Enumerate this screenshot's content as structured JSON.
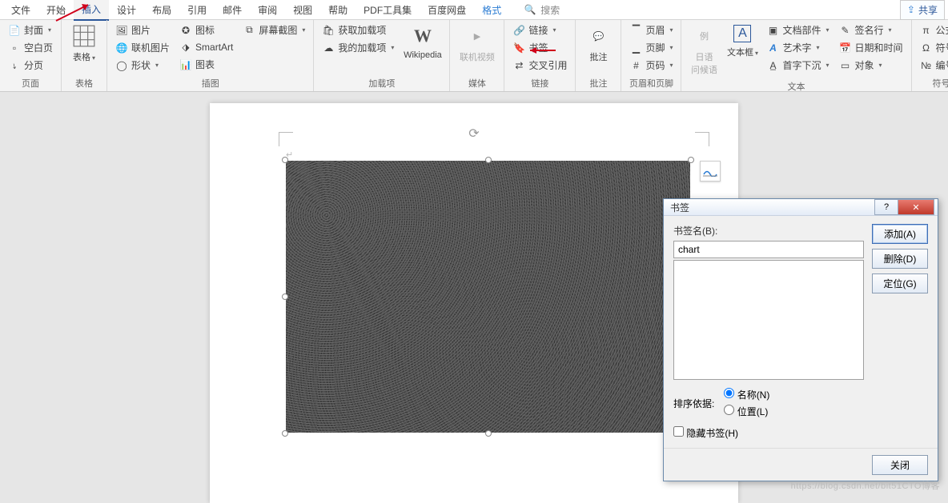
{
  "menu": {
    "items": [
      "文件",
      "开始",
      "插入",
      "设计",
      "布局",
      "引用",
      "邮件",
      "审阅",
      "视图",
      "帮助",
      "PDF工具集",
      "百度网盘",
      "格式"
    ],
    "active_index": 2,
    "format_index": 12,
    "search_placeholder": "搜索",
    "share": "共享"
  },
  "ribbon": {
    "pages": {
      "title": "页面",
      "cover": "封面",
      "blank": "空白页",
      "break": "分页"
    },
    "tables": {
      "title": "表格",
      "table": "表格"
    },
    "illus": {
      "title": "插图",
      "picture": "图片",
      "online_pic": "联机图片",
      "shapes": "形状",
      "icons": "图标",
      "smartart": "SmartArt",
      "chart": "图表",
      "screenshot": "屏幕截图"
    },
    "addins": {
      "title": "加载项",
      "get": "获取加载项",
      "my": "我的加载项",
      "wiki": "Wikipedia"
    },
    "media": {
      "title": "媒体",
      "video": "联机视频"
    },
    "links": {
      "title": "链接",
      "link": "链接",
      "bookmark": "书签",
      "xref": "交叉引用"
    },
    "comments": {
      "title": "批注",
      "comment": "批注"
    },
    "headerfooter": {
      "title": "页眉和页脚",
      "header": "页眉",
      "footer": "页脚",
      "pagenum": "页码"
    },
    "text": {
      "title": "文本",
      "jp": "日语\n问候语",
      "textbox": "文本框",
      "parts": "文档部件",
      "wordart": "艺术字",
      "dropcap": "首字下沉",
      "sigline": "签名行",
      "datetime": "日期和时间",
      "object": "对象"
    },
    "symbols": {
      "title": "符号",
      "equation": "公式",
      "symbol": "符号",
      "number": "编号"
    }
  },
  "dialog": {
    "title": "书签",
    "name_label": "书签名(B):",
    "name_value": "chart",
    "add": "添加(A)",
    "delete": "删除(D)",
    "goto": "定位(G)",
    "sort_label": "排序依据:",
    "sort_name": "名称(N)",
    "sort_loc": "位置(L)",
    "hidden": "隐藏书签(H)",
    "close": "关闭"
  },
  "watermark": "https://blog.csdn.net/bit51CTO博客"
}
